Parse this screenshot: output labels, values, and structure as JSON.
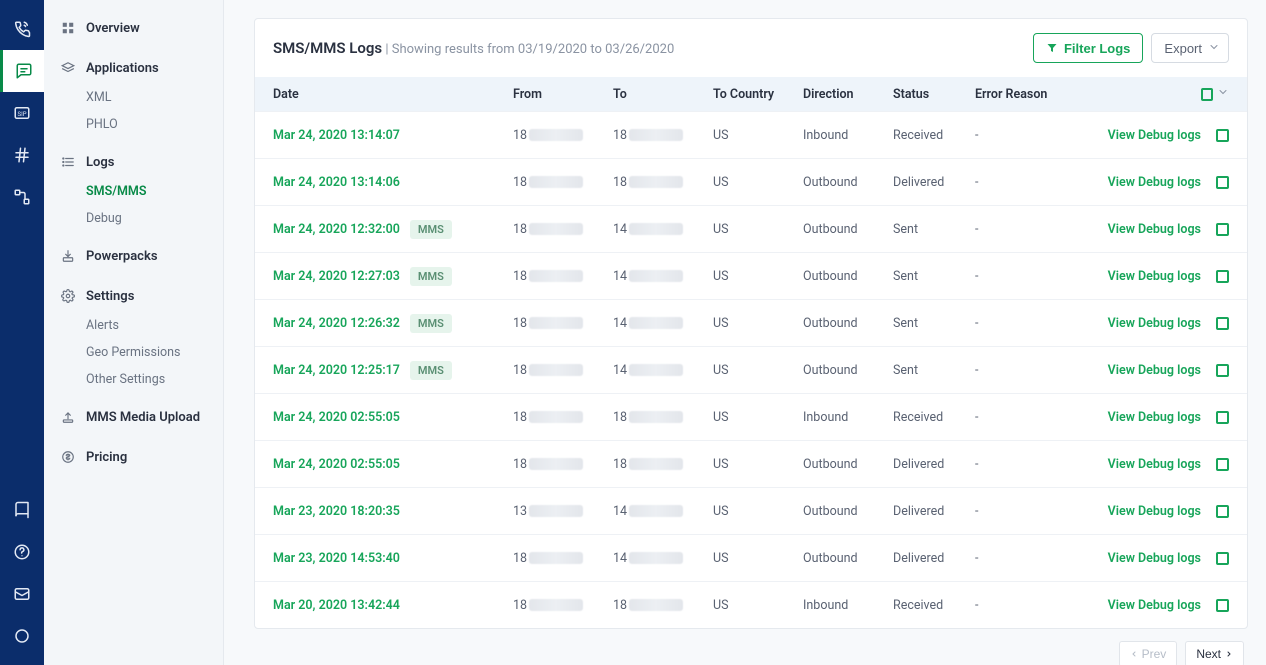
{
  "header": {
    "title": "SMS/MMS Logs",
    "subtitle": "Showing results from 03/19/2020 to 03/26/2020",
    "filter_label": "Filter Logs",
    "export_label": "Export"
  },
  "sidebar": {
    "overview": "Overview",
    "applications": "Applications",
    "app_xml": "XML",
    "app_phlo": "PHLO",
    "logs": "Logs",
    "logs_sms": "SMS/MMS",
    "logs_debug": "Debug",
    "powerpacks": "Powerpacks",
    "settings": "Settings",
    "settings_alerts": "Alerts",
    "settings_geo": "Geo Permissions",
    "settings_other": "Other Settings",
    "mms_upload": "MMS Media Upload",
    "pricing": "Pricing"
  },
  "columns": {
    "date": "Date",
    "from": "From",
    "to": "To",
    "to_country": "To Country",
    "direction": "Direction",
    "status": "Status",
    "error": "Error Reason"
  },
  "view_label": "View Debug logs",
  "mms_label": "MMS",
  "rows": [
    {
      "date": "Mar 24, 2020 13:14:07",
      "mms": false,
      "from": "18",
      "to": "18",
      "country": "US",
      "direction": "Inbound",
      "status": "Received",
      "error": "-"
    },
    {
      "date": "Mar 24, 2020 13:14:06",
      "mms": false,
      "from": "18",
      "to": "18",
      "country": "US",
      "direction": "Outbound",
      "status": "Delivered",
      "error": "-"
    },
    {
      "date": "Mar 24, 2020 12:32:00",
      "mms": true,
      "from": "18",
      "to": "14",
      "country": "US",
      "direction": "Outbound",
      "status": "Sent",
      "error": "-"
    },
    {
      "date": "Mar 24, 2020 12:27:03",
      "mms": true,
      "from": "18",
      "to": "14",
      "country": "US",
      "direction": "Outbound",
      "status": "Sent",
      "error": "-"
    },
    {
      "date": "Mar 24, 2020 12:26:32",
      "mms": true,
      "from": "18",
      "to": "14",
      "country": "US",
      "direction": "Outbound",
      "status": "Sent",
      "error": "-"
    },
    {
      "date": "Mar 24, 2020 12:25:17",
      "mms": true,
      "from": "18",
      "to": "14",
      "country": "US",
      "direction": "Outbound",
      "status": "Sent",
      "error": "-"
    },
    {
      "date": "Mar 24, 2020 02:55:05",
      "mms": false,
      "from": "18",
      "to": "18",
      "country": "US",
      "direction": "Inbound",
      "status": "Received",
      "error": "-"
    },
    {
      "date": "Mar 24, 2020 02:55:05",
      "mms": false,
      "from": "18",
      "to": "18",
      "country": "US",
      "direction": "Outbound",
      "status": "Delivered",
      "error": "-"
    },
    {
      "date": "Mar 23, 2020 18:20:35",
      "mms": false,
      "from": "13",
      "to": "14",
      "country": "US",
      "direction": "Outbound",
      "status": "Delivered",
      "error": "-"
    },
    {
      "date": "Mar 23, 2020 14:53:40",
      "mms": false,
      "from": "18",
      "to": "14",
      "country": "US",
      "direction": "Outbound",
      "status": "Delivered",
      "error": "-"
    },
    {
      "date": "Mar 20, 2020 13:42:44",
      "mms": false,
      "from": "18",
      "to": "18",
      "country": "US",
      "direction": "Inbound",
      "status": "Received",
      "error": "-"
    }
  ],
  "pager": {
    "prev": "Prev",
    "next": "Next"
  }
}
